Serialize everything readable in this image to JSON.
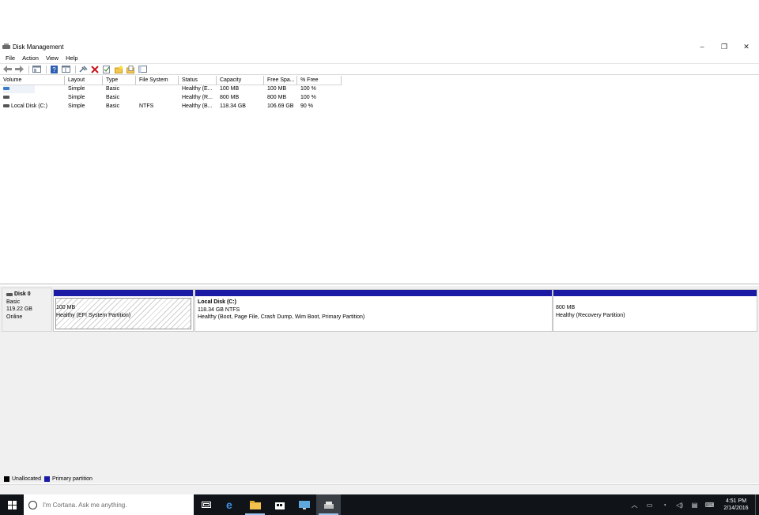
{
  "window": {
    "title": "Disk Management",
    "minimize": "–",
    "restore": "❐",
    "close": "✕"
  },
  "menu": [
    "File",
    "Action",
    "View",
    "Help"
  ],
  "columns": [
    "Volume",
    "Layout",
    "Type",
    "File System",
    "Status",
    "Capacity",
    "Free Spa...",
    "% Free"
  ],
  "volumes": [
    {
      "volume": "",
      "layout": "Simple",
      "type": "Basic",
      "fs": "",
      "status": "Healthy (E...",
      "capacity": "100 MB",
      "free": "100 MB",
      "pct": "100 %"
    },
    {
      "volume": "",
      "layout": "Simple",
      "type": "Basic",
      "fs": "",
      "status": "Healthy (R...",
      "capacity": "800 MB",
      "free": "800 MB",
      "pct": "100 %"
    },
    {
      "volume": "Local Disk (C:)",
      "layout": "Simple",
      "type": "Basic",
      "fs": "NTFS",
      "status": "Healthy (B...",
      "capacity": "118.34 GB",
      "free": "106.69 GB",
      "pct": "90 %"
    }
  ],
  "disk": {
    "name": "Disk 0",
    "type": "Basic",
    "size": "119.22 GB",
    "state": "Online"
  },
  "partitions": [
    {
      "title": "",
      "size": "100 MB",
      "status": "Healthy (EFI System Partition)"
    },
    {
      "title": "Local Disk  (C:)",
      "size": "118.34 GB NTFS",
      "status": "Healthy (Boot, Page File, Crash Dump, Wim Boot, Primary Partition)"
    },
    {
      "title": "",
      "size": "800 MB",
      "status": "Healthy (Recovery Partition)"
    }
  ],
  "legend": {
    "unallocated": "Unallocated",
    "primary": "Primary partition",
    "unallocated_color": "#000000",
    "primary_color": "#1a1aa5"
  },
  "taskbar": {
    "search_placeholder": "I'm Cortana. Ask me anything.",
    "time": "4:51 PM",
    "date": "2/14/2016"
  }
}
